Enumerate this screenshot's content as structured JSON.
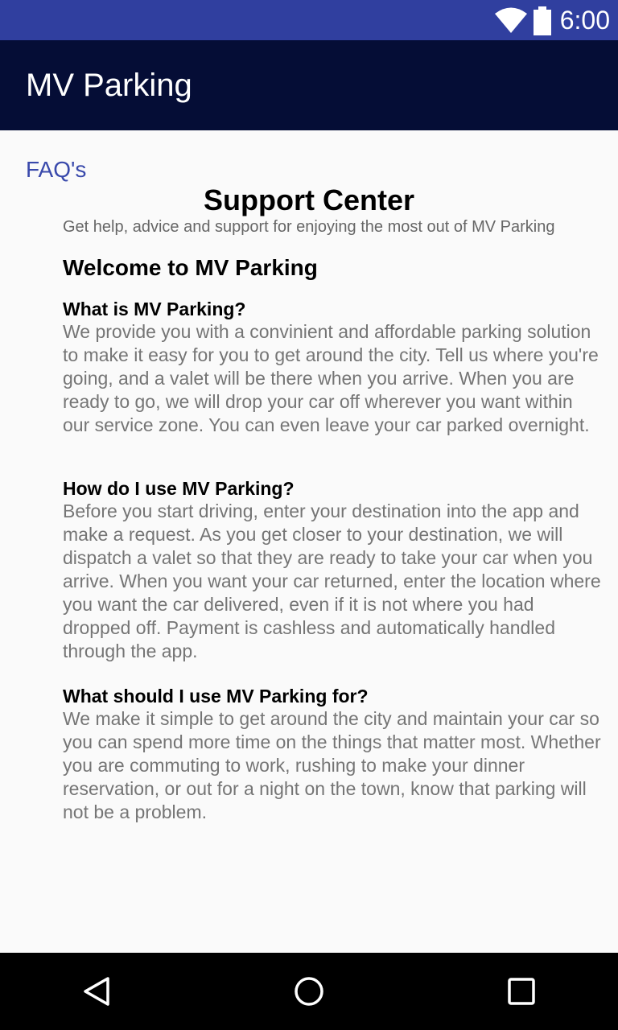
{
  "status_bar": {
    "time": "6:00",
    "icons": [
      "wifi-icon",
      "battery-icon"
    ]
  },
  "app_bar": {
    "title": "MV Parking",
    "color": "#050d36"
  },
  "content": {
    "faq_link": "FAQ's",
    "support_title": "Support Center",
    "support_subtitle": "Get help, advice and support for enjoying the most out of MV Parking",
    "welcome": "Welcome to MV Parking",
    "faqs": [
      {
        "question": "What is MV Parking?",
        "answer": "We provide you with a convinient and affordable parking solution to make it easy for you to get around the city. Tell us where you're going, and a valet will be there when you arrive. When you are ready to go, we will drop your car off wherever you want within our service zone. You can even leave your car parked overnight."
      },
      {
        "question": "How do I use MV Parking?",
        "answer": "Before you start driving, enter your destination into the app and make a request. As you get closer to your destination, we will dispatch a valet so that they are ready to take your car when you arrive. When you want your car returned, enter the location where you want the car delivered, even if it is not where you had dropped off. Payment is cashless and automatically handled through the app."
      },
      {
        "question": "What should I use MV Parking for?",
        "answer": "We make it simple to get around the city and maintain your car so you can spend more time on the things that matter most. Whether you are commuting to work, rushing to make your dinner reservation, or out for a night on the town, know that parking will not be a problem."
      }
    ]
  },
  "nav_bar": {
    "icons": [
      "back-icon",
      "home-icon",
      "recent-apps-icon"
    ]
  },
  "colors": {
    "status_bar": "#303f9f",
    "app_bar": "#050d36",
    "link": "#3949ab",
    "answer_text": "#757575"
  }
}
